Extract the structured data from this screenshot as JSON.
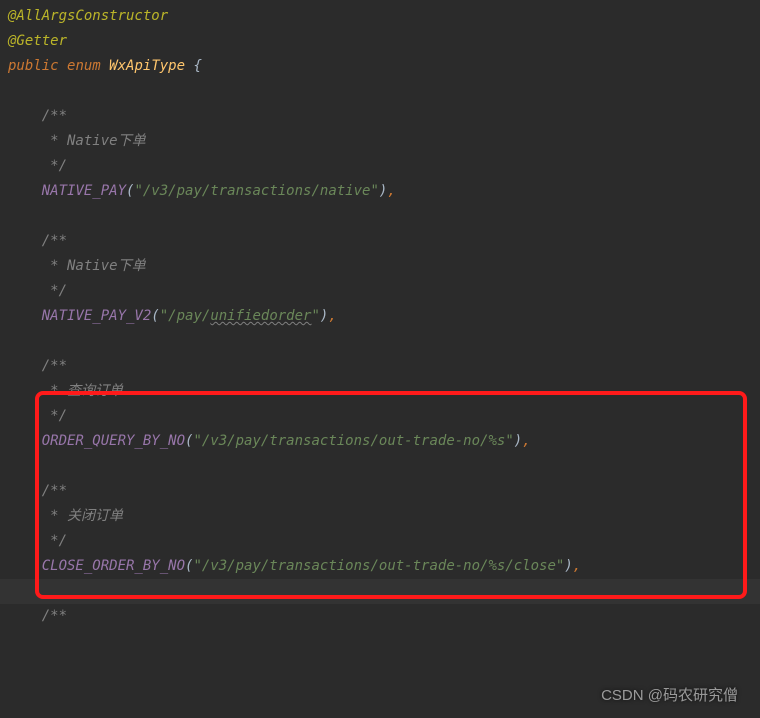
{
  "code": {
    "annotation1": "@AllArgsConstructor",
    "annotation2": "@Getter",
    "kw_public": "public",
    "kw_enum": "enum",
    "class_name": "WxApiType",
    "brace_open": "{",
    "comment_open": "/**",
    "comment_star": " *",
    "comment_close": " */",
    "comment_native": " * Native下单",
    "comment_query": " * 查询订单",
    "comment_close_order": " * 关闭订单",
    "const_native_pay": "NATIVE_PAY",
    "str_native_pay": "\"/v3/pay/transactions/native\"",
    "const_native_pay_v2": "NATIVE_PAY_V2",
    "str_native_pay_v2_a": "\"/pay/",
    "str_native_pay_v2_b": "unifiedorder",
    "str_native_pay_v2_c": "\"",
    "const_order_query": "ORDER_QUERY_BY_NO",
    "str_order_query": "\"/v3/pay/transactions/out-trade-no/%s\"",
    "const_close_order": "CLOSE_ORDER_BY_NO",
    "str_close_order": "\"/v3/pay/transactions/out-trade-no/%s/close\"",
    "paren_open": "(",
    "paren_close": ")",
    "comma": ","
  },
  "watermark": "CSDN @码农研究僧"
}
